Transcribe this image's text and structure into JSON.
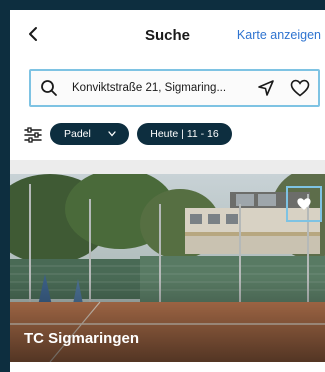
{
  "header": {
    "title": "Suche",
    "map_link": "Karte anzeigen"
  },
  "search": {
    "value": "Konviktstraße 21, Sigmaring..."
  },
  "filters": {
    "sport_chip": "Padel",
    "date_chip": "Heute | 11 - 16"
  },
  "results": [
    {
      "club_name": "TC Sigmaringen",
      "favorited": true
    }
  ],
  "colors": {
    "brand_dark": "#0d2e3f",
    "link_blue": "#2f74d0",
    "highlight": "#7ec3e3"
  }
}
